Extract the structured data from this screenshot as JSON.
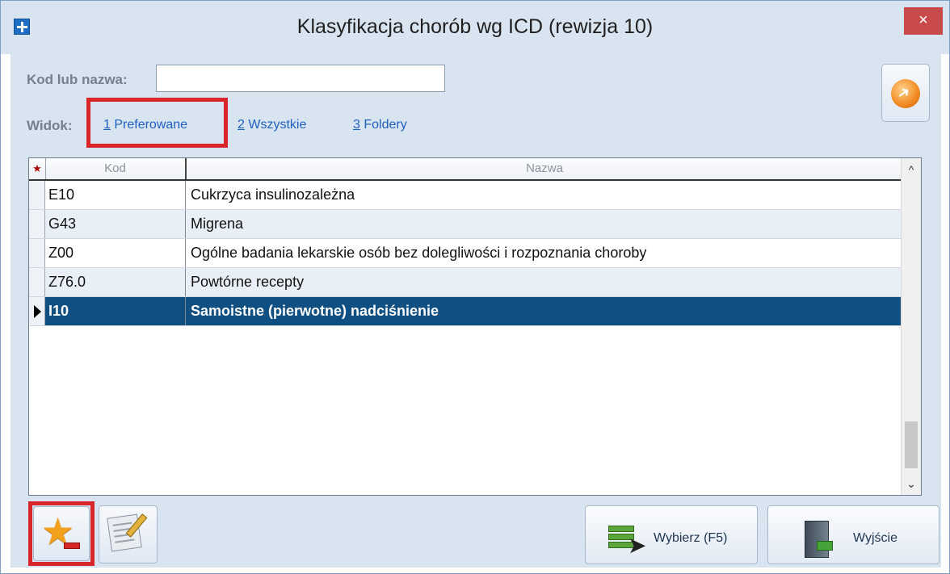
{
  "window": {
    "title": "Klasyfikacja chorób wg ICD (rewizja 10)",
    "close_glyph": "×"
  },
  "search": {
    "label": "Kod lub nazwa:",
    "value": ""
  },
  "view": {
    "label": "Widok:",
    "options": [
      {
        "key": "1",
        "label": "Preferowane",
        "selected": true
      },
      {
        "key": "2",
        "label": "Wszystkie",
        "selected": false
      },
      {
        "key": "3",
        "label": "Foldery",
        "selected": false
      }
    ]
  },
  "grid": {
    "marker_glyph": "★",
    "columns": {
      "kod": "Kod",
      "nazwa": "Nazwa"
    },
    "rows": [
      {
        "kod": "E10",
        "nazwa": "Cukrzyca insulinozależna"
      },
      {
        "kod": "G43",
        "nazwa": "Migrena"
      },
      {
        "kod": "Z00",
        "nazwa": "Ogólne badania lekarskie osób bez dolegliwości i rozpoznania choroby"
      },
      {
        "kod": "Z76.0",
        "nazwa": "Powtórne recepty"
      },
      {
        "kod": "I10",
        "nazwa": "Samoistne (pierwotne) nadciśnienie"
      }
    ],
    "selected_row": 4,
    "scroll": {
      "up_glyph": "^",
      "down_glyph": "⌄"
    }
  },
  "buttons": {
    "select_label": "Wybierz (F5)",
    "exit_label": "Wyjście",
    "star_glyph": "★"
  },
  "colors": {
    "selection": "#0f4f82",
    "highlight": "#d9262a",
    "link": "#1e5fbf"
  },
  "icons": [
    "app-plus-icon",
    "close-icon",
    "refresh-icon",
    "favorite-remove-icon",
    "edit-note-icon",
    "select-list-icon",
    "exit-door-icon"
  ]
}
